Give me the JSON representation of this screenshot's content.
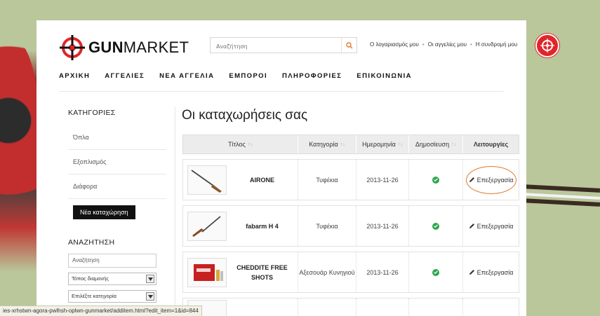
{
  "brand": {
    "name_prefix": "GUN",
    "name_suffix": "MARKET",
    "accent": "#e0262a"
  },
  "header": {
    "search_placeholder": "Αναζήτηση",
    "links": [
      "Ο λογαριασμός μου",
      "Οι αγγελίες μου",
      "Η συνδρομή μου"
    ]
  },
  "nav": [
    "ΑΡΧΙΚΗ",
    "ΑΓΓΕΛΙΕΣ",
    "ΝΕΑ ΑΓΓΕΛΙΑ",
    "ΕΜΠΟΡΟΙ",
    "ΠΛΗΡΟΦΟΡΙΕΣ",
    "ΕΠΙΚΟΙΝΩΝΙΑ"
  ],
  "sidebar": {
    "categories_title": "ΚΑΤΗΓΟΡΙΕΣ",
    "categories": [
      "Όπλα",
      "Εξοπλισμός",
      "Διάφορα"
    ],
    "new_button": "Νέα καταχώρηση",
    "search_title": "ΑΝΑΖΗΤΗΣΗ",
    "search_placeholder": "Αναζήτηση",
    "location_select": "Τόπος διαμονής",
    "category_select": "Επιλέξτε κατηγορία"
  },
  "main": {
    "title": "Οι καταχωρήσεις σας",
    "columns": [
      "Τίτλος",
      "Κατηγορία",
      "Ημερομηνία",
      "Δημοσίευση",
      "Λειτουργίες"
    ],
    "rows": [
      {
        "title": "AIRONE",
        "category": "Τυφέκια",
        "date": "2013-11-26",
        "action": "Επεξεργασία"
      },
      {
        "title": "fabarm H 4",
        "category": "Τυφέκια",
        "date": "2013-11-26",
        "action": "Επεξεργασία"
      },
      {
        "title": "CHEDDITE FREE SHOTS",
        "category": "Αξεσουάρ Κυνηγιού",
        "date": "2013-11-26",
        "action": "Επεξεργασία"
      }
    ]
  },
  "status_bar": "ies-xrhstwn-agora-pwlhsh-oplwn-gunmarket/additem.html?edit_item=1&id=844"
}
